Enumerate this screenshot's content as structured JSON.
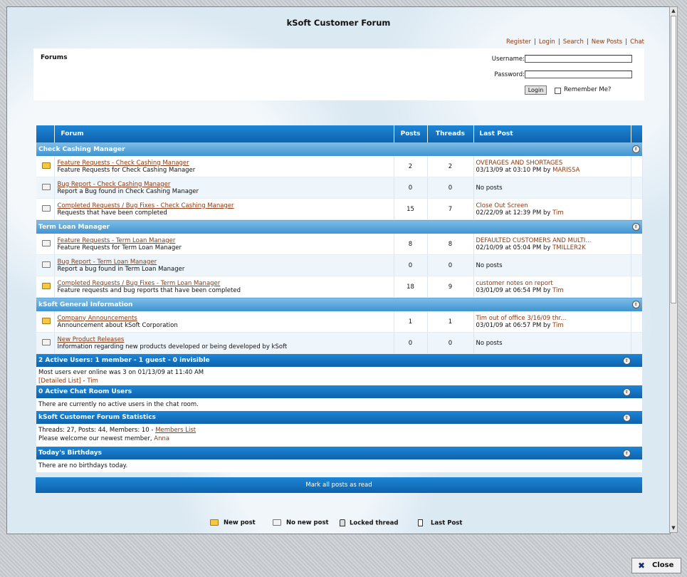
{
  "title": "kSoft Customer Forum",
  "top_links": [
    "Register",
    "Login",
    "Search",
    "New Posts",
    "Chat"
  ],
  "login": {
    "section_label": "Forums",
    "username_label": "Username:",
    "password_label": "Password:",
    "username_value": "",
    "password_value": "",
    "login_button": "Login",
    "remember_label": "Remember Me?"
  },
  "table_headers": {
    "forum": "Forum",
    "posts": "Posts",
    "threads": "Threads",
    "last_post": "Last Post"
  },
  "categories": [
    {
      "name": "Check Cashing Manager",
      "forums": [
        {
          "title": "Feature Requests - Check Cashing Manager",
          "desc": "Feature Requests for Check Cashing Manager",
          "posts": "2",
          "threads": "2",
          "last_title": "OVERAGES AND SHORTAGES",
          "last_date": "03/13/09 at 03:10 PM by",
          "last_user": "MARISSA",
          "new": true
        },
        {
          "title": "Bug Report - Check Cashing Manager",
          "desc": "Report a Bug found in Check Cashing Manager",
          "posts": "0",
          "threads": "0",
          "last_title": "",
          "last_date": "No posts",
          "last_user": "",
          "new": false
        },
        {
          "title": "Completed Requests / Bug Fixes - Check Cashing Manager",
          "desc": "Requests that have been completed",
          "posts": "15",
          "threads": "7",
          "last_title": "Close Out Screen",
          "last_date": "02/22/09 at 12:39 PM by",
          "last_user": "Tim",
          "new": false
        }
      ]
    },
    {
      "name": "Term Loan Manager",
      "forums": [
        {
          "title": "Feature Requests - Term Loan Manager",
          "desc": "Feature Requests for Term Loan Manager",
          "posts": "8",
          "threads": "8",
          "last_title": "DEFAULTED CUSTOMERS AND MULTI...",
          "last_date": "02/10/09 at 05:04 PM by",
          "last_user": "TMILLER2K",
          "new": false
        },
        {
          "title": "Bug Report - Term Loan Manager",
          "desc": "Report a bug found in Term Loan Manager",
          "posts": "0",
          "threads": "0",
          "last_title": "",
          "last_date": "No posts",
          "last_user": "",
          "new": false
        },
        {
          "title": "Completed Requests / Bug Fixes - Term Loan Manager",
          "desc": "Feature requests and bug reports that have been completed",
          "posts": "18",
          "threads": "9",
          "last_title": "customer notes on report",
          "last_date": "03/01/09 at 06:54 PM by",
          "last_user": "Tim",
          "new": true
        }
      ]
    },
    {
      "name": "kSoft General Information",
      "forums": [
        {
          "title": "Company Announcements",
          "desc": "Announcement about kSoft Corporation",
          "posts": "1",
          "threads": "1",
          "last_title": "Tim out of office 3/16/09 thr...",
          "last_date": "03/01/09 at 06:57 PM by",
          "last_user": "Tim",
          "new": true
        },
        {
          "title": "New Product Releases",
          "desc": "Information regarding new products developed or being developed by kSoft",
          "posts": "0",
          "threads": "0",
          "last_title": "",
          "last_date": "No posts",
          "last_user": "",
          "new": false
        }
      ]
    }
  ],
  "active_users": {
    "header": "2 Active Users: 1 member - 1 guest - 0 invisible",
    "most_online": "Most users ever online was 3 on 01/13/09 at 11:40 AM",
    "detailed_link": "[Detailed List]",
    "sep": " - ",
    "user": "Tim"
  },
  "chat": {
    "header": "0 Active Chat Room Users",
    "body": "There are currently no active users in the chat room."
  },
  "stats": {
    "header": "kSoft Customer Forum Statistics",
    "line1": "Threads: 27, Posts: 44, Members: 10 - ",
    "members_link": "Members List",
    "line2": "Please welcome our newest member, ",
    "newest_member": "Anna"
  },
  "birthdays": {
    "header": "Today's Birthdays",
    "body": "There are no birthdays today."
  },
  "mark_all": "Mark all posts as read",
  "legend": [
    "New post",
    "No new post",
    "Locked thread",
    "Last Post"
  ],
  "close_button": "Close"
}
